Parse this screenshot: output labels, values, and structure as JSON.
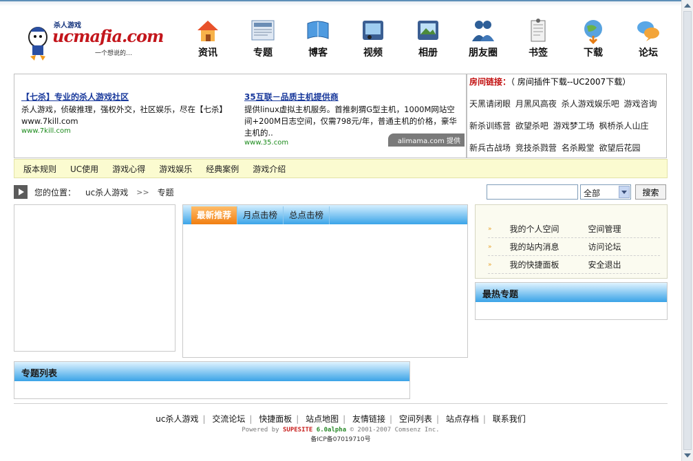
{
  "logo": {
    "tag": "杀人游戏",
    "mark": "ucmafia.com",
    "slogan": "一个想说的…"
  },
  "nav": [
    {
      "label": "资讯",
      "icon": "house-icon"
    },
    {
      "label": "专题",
      "icon": "newspaper-icon"
    },
    {
      "label": "博客",
      "icon": "book-icon"
    },
    {
      "label": "视频",
      "icon": "video-icon"
    },
    {
      "label": "相册",
      "icon": "photo-icon"
    },
    {
      "label": "朋友圈",
      "icon": "friends-icon"
    },
    {
      "label": "书签",
      "icon": "bookmark-icon"
    },
    {
      "label": "下载",
      "icon": "globe-download-icon"
    },
    {
      "label": "论坛",
      "icon": "chat-bubbles-icon"
    }
  ],
  "ads": [
    {
      "title": "【七杀】专业的杀人游戏社区",
      "desc": "杀人游戏，侦破推理，强权外交，社区娱乐，尽在【七杀】 www.7kill.com",
      "url": "www.7kill.com"
    },
    {
      "title": "35互联－品质主机提供商",
      "desc": "提供linux虚拟主机服务。首推刺猬G型主机，1000M网站空间+200M日志空间，仅需798元/年，普通主机的价格，豪华主机的..",
      "url": "www.35.com"
    }
  ],
  "ad_badge": "alimama.com 提供",
  "room_links": {
    "label": "房间链接：",
    "extra": "（ 房间插件下载--UC2007下载）",
    "rows": [
      [
        "天黑请闭眼",
        "月黑风高夜",
        "杀人游戏娱乐吧",
        "游戏咨询"
      ],
      [
        "新杀训练营",
        "欲望杀吧",
        "游戏梦工场",
        "枫桥杀人山庄"
      ],
      [
        "新兵古战场",
        "竞技杀戮营",
        "名杀殿堂",
        "欲望后花园"
      ]
    ]
  },
  "menu": [
    "版本规则",
    "UC使用",
    "游戏心得",
    "游戏娱乐",
    "经典案例",
    "游戏介绍"
  ],
  "breadcrumb": {
    "label": "您的位置：",
    "home": "uc杀人游戏",
    "sep": ">>",
    "current": "专题"
  },
  "search": {
    "placeholder": "",
    "scope": "全部",
    "button": "搜索"
  },
  "tabs": [
    "最新推荐",
    "月点击榜",
    "总点击榜"
  ],
  "user_panel": [
    [
      "我的个人空间",
      "空间管理"
    ],
    [
      "我的站内消息",
      "访问论坛"
    ],
    [
      "我的快捷面板",
      "安全退出"
    ]
  ],
  "hot_title": "最热专题",
  "list_title": "专题列表",
  "footer": {
    "links": [
      "uc杀人游戏",
      "交流论坛",
      "快捷面板",
      "站点地图",
      "友情链接",
      "空间列表",
      "站点存档",
      "联系我们"
    ],
    "powered_prefix": "Powered by",
    "powered_brand": "SUPESITE",
    "powered_version": "6.0alpha",
    "powered_suffix": "© 2001-2007 Comsenz Inc.",
    "icp": "备ICP备07019710号"
  }
}
